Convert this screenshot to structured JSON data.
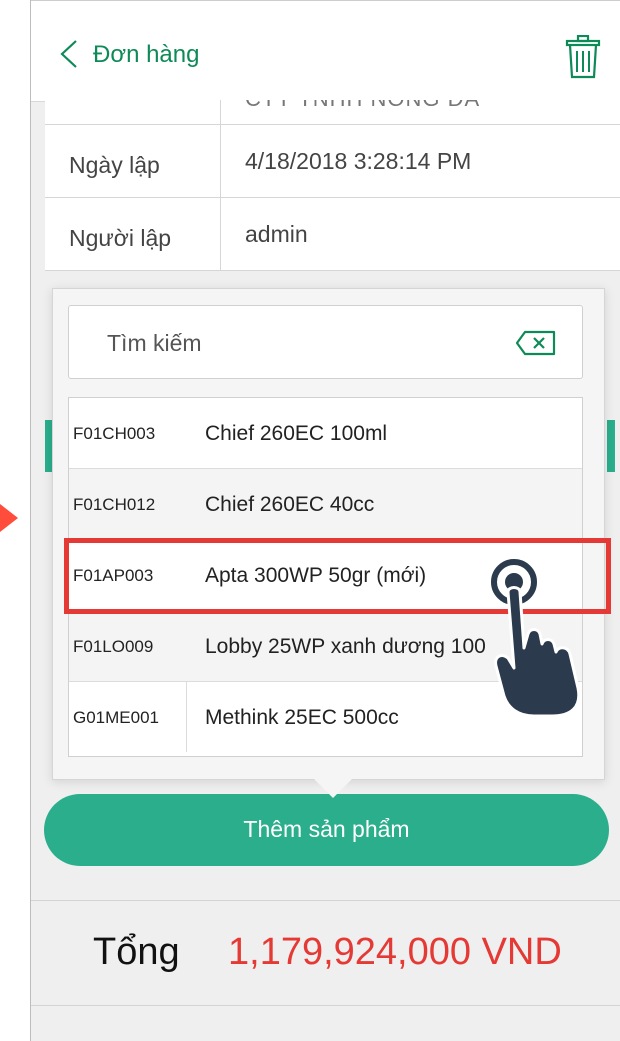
{
  "nav": {
    "title": "Đơn hàng",
    "back_icon": "chevron-left-icon",
    "delete_icon": "trash-icon"
  },
  "info": {
    "clipped_value": "CTY TNHH NÔNG ĐÀ",
    "rows": [
      {
        "label": "Ngày lập",
        "value": "4/18/2018 3:28:14 PM"
      },
      {
        "label": "Người lập",
        "value": "admin"
      }
    ]
  },
  "popup": {
    "search_placeholder": "Tìm kiếm",
    "clear_icon": "backspace-icon",
    "items": [
      {
        "code": "F01CH003",
        "name": "Chief 260EC 100ml"
      },
      {
        "code": "F01CH012",
        "name": "Chief 260EC 40cc"
      },
      {
        "code": "F01AP003",
        "name": "Apta 300WP 50gr (mới)"
      },
      {
        "code": "F01LO009",
        "name": "Lobby 25WP xanh dương 100"
      },
      {
        "code": "G01ME001",
        "name": "Methink 25EC 500cc"
      }
    ],
    "selected_index": 2
  },
  "add_button": {
    "label": "Thêm sản phẩm"
  },
  "total": {
    "label": "Tổng",
    "value": "1,179,924,000 VND"
  },
  "colors": {
    "brand": "#2aae8c",
    "nav_title": "#0d8a58",
    "total_value": "#e53935",
    "highlight": "#e53935"
  }
}
